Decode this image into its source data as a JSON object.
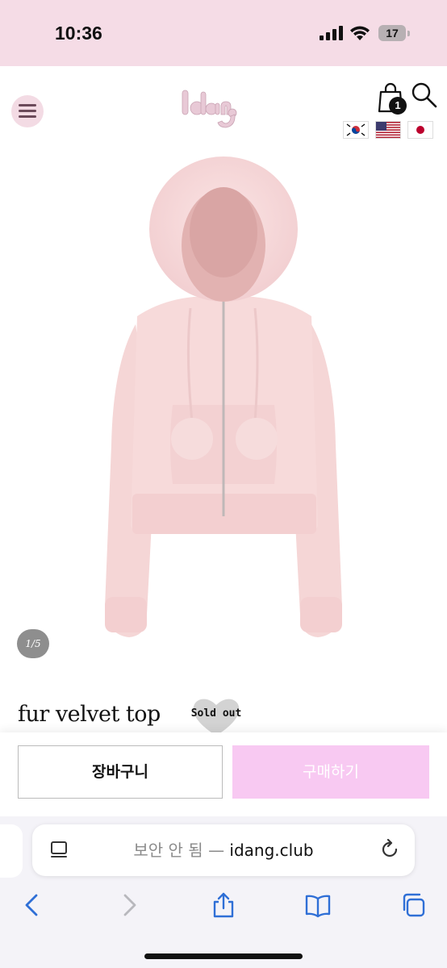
{
  "status_bar": {
    "time": "10:36",
    "battery": "17"
  },
  "header": {
    "logo_text": "idang",
    "cart_count": "1",
    "languages": [
      "korean-flag",
      "us-flag",
      "japan-flag"
    ]
  },
  "product": {
    "image_pager": "1/5",
    "title": "fur velvet top",
    "badge": "Sold out"
  },
  "actions": {
    "cart_label": "장바구니",
    "buy_label": "구매하기"
  },
  "browser": {
    "url_prefix": "보안 안 됨 — ",
    "url_domain": "idang.club"
  },
  "colors": {
    "status_bg": "#f5dce6",
    "buy_button": "#f8c9f2",
    "menu_circle": "#f3dbe4",
    "product_pink": "#f5d4d4"
  }
}
